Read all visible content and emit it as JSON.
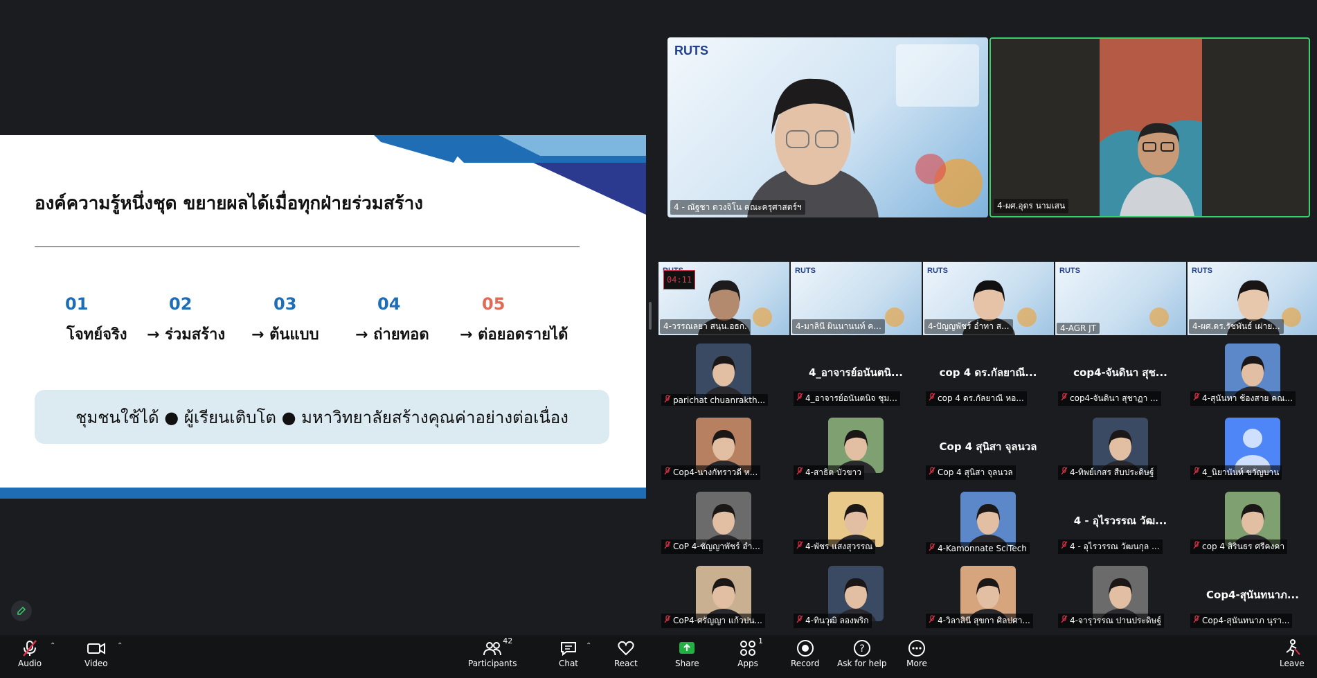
{
  "slide": {
    "title": "องค์ความรู้หนึ่งชุด ขยายผลได้เมื่อทุกฝ่ายร่วมสร้าง",
    "steps": [
      {
        "num": "01",
        "label": "โจทย์จริง"
      },
      {
        "num": "02",
        "label": "→ ร่วมสร้าง"
      },
      {
        "num": "03",
        "label": "→ ต้นแบบ"
      },
      {
        "num": "04",
        "label": "→ ถ่ายทอด"
      },
      {
        "num": "05",
        "label": "→ ต่อยอดรายได้"
      }
    ],
    "banner": "ชุมชนใช้ได้ ● ผู้เรียนเติบโต ● มหาวิทยาลัยสร้างคุณค่าอย่างต่อเนื่อง",
    "step5_color": "#e06b56"
  },
  "speakers": [
    {
      "label": "4 - ณัฐชา ดวงจิโน คณะครุศาสตร์ฯ"
    },
    {
      "label": "4-ผศ.อุดร นามเสน"
    }
  ],
  "strip": {
    "timer": "04:11",
    "tiles": [
      "4-วรรณลยา สนฺน.อธก.",
      "4-มาลินี ผินนานนท์ ค...",
      "4-ปัญญพัชร์ อ่ำทา ส...",
      "4-AGR JT",
      "4-ผศ.ดร.รัชพันธ์ เผ่าย..."
    ],
    "next_arrow": "›"
  },
  "gallery": [
    {
      "label": "parichat chuanrakth...",
      "name": "",
      "avatar": "photo"
    },
    {
      "label": "4_อาจารย์อนันตนิจ ชุม...",
      "name": "4_อาจารย์อนันตนิ...",
      "avatar": "none"
    },
    {
      "label": "cop 4 ดร.กัลยาณี หอ...",
      "name": "cop 4 ดร.กัลยาณี...",
      "avatar": "none"
    },
    {
      "label": "cop4-จันดินา สุชาฏา ...",
      "name": "cop4-จันดินา สุช...",
      "avatar": "none"
    },
    {
      "label": "4-สุนันทา ช้องสาย คณ...",
      "name": "",
      "avatar": "photo"
    },
    {
      "label": "Cop4-นางกัทราวดี ห...",
      "name": "",
      "avatar": "photo"
    },
    {
      "label": "4-สาธิต บัวขาว",
      "name": "",
      "avatar": "photo"
    },
    {
      "label": "Cop 4 สุนิสา จุลนวล",
      "name": "Cop 4 สุนิสา จุลนวล",
      "avatar": "none"
    },
    {
      "label": "4-ทิพย์เกสร สืบประดิษฐ์",
      "name": "",
      "avatar": "photo"
    },
    {
      "label": "4_นิยานันท์ ขวัญบาน",
      "name": "",
      "avatar": "generic"
    },
    {
      "label": "CoP 4-ชัญญาพัชร์ อำ...",
      "name": "",
      "avatar": "photo"
    },
    {
      "label": "4-พัชร แสงสุวรรณ",
      "name": "",
      "avatar": "photo"
    },
    {
      "label": "4-Kamonnate SciTech",
      "name": "",
      "avatar": "photo"
    },
    {
      "label": "4 - อุไรวรรณ วัฒนกุล ...",
      "name": "4 - อุไรวรรณ วัฒ...",
      "avatar": "none"
    },
    {
      "label": "cop 4 สิรินธร ศรีคงคา",
      "name": "",
      "avatar": "photo"
    },
    {
      "label": "CoP4-ศรัญญา แก้วปน...",
      "name": "",
      "avatar": "photo"
    },
    {
      "label": "4-ทินวุฒิ ลองพริก",
      "name": "",
      "avatar": "photo"
    },
    {
      "label": "4-วิลาสินี สุขกา ศิลปศา...",
      "name": "",
      "avatar": "photo"
    },
    {
      "label": "4-จารุวรรณ ปานประดิษฐ์",
      "name": "",
      "avatar": "photo"
    },
    {
      "label": "Cop4-สุนันทนาภ นุรา...",
      "name": "Cop4-สุนันทนาภ...",
      "avatar": "none"
    }
  ],
  "toolbar": {
    "audio": "Audio",
    "video": "Video",
    "participants": "Participants",
    "participants_count": "42",
    "chat": "Chat",
    "react": "React",
    "share": "Share",
    "apps": "Apps",
    "apps_count": "1",
    "record": "Record",
    "help": "Ask for help",
    "more": "More",
    "leave": "Leave"
  },
  "colors": {
    "accent_blue": "#1f6db5",
    "share_green": "#1fb141",
    "active_speaker_border": "#36d36c",
    "muted_red": "#e0334a"
  }
}
